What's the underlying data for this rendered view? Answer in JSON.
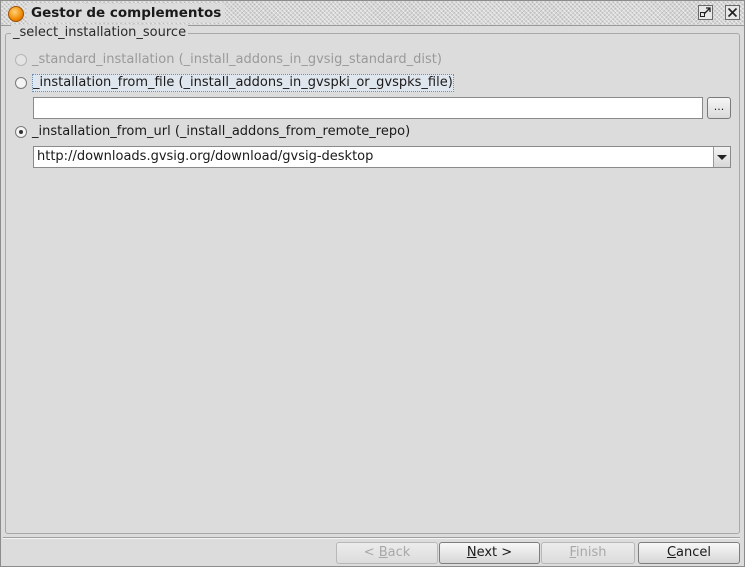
{
  "window": {
    "title": "Gestor de complementos",
    "icons": {
      "app": "gvsig-app-icon",
      "restore": "restore-window-icon",
      "close": "close-icon"
    }
  },
  "group": {
    "legend": "_select_installation_source"
  },
  "options": [
    {
      "label": "_standard_installation (_install_addons_in_gvsig_standard_dist)",
      "selected": false,
      "enabled": false
    },
    {
      "label": "_installation_from_file (_install_addons_in_gvspki_or_gvspks_file)",
      "selected": false,
      "enabled": true
    },
    {
      "label": "_installation_from_url (_install_addons_from_remote_repo)",
      "selected": true,
      "enabled": true
    }
  ],
  "file_path": {
    "value": "",
    "browse_label": "..."
  },
  "url_combo": {
    "value": "http://downloads.gvsig.org/download/gvsig-desktop"
  },
  "buttons": {
    "back": {
      "prefix": "< ",
      "mnemonic": "B",
      "rest": "ack",
      "enabled": false
    },
    "next": {
      "mnemonic": "N",
      "rest": "ext >",
      "enabled": true
    },
    "finish": {
      "mnemonic": "F",
      "rest": "inish",
      "enabled": false
    },
    "cancel": {
      "mnemonic": "C",
      "rest": "ancel",
      "enabled": true
    }
  }
}
